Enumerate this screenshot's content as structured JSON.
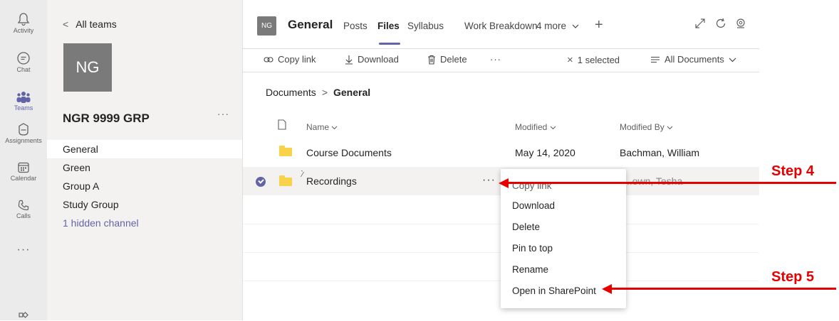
{
  "rail": {
    "items": [
      {
        "label": "Activity",
        "icon": "bell-icon"
      },
      {
        "label": "Chat",
        "icon": "chat-icon"
      },
      {
        "label": "Teams",
        "icon": "teams-icon"
      },
      {
        "label": "Assignments",
        "icon": "assignments-icon"
      },
      {
        "label": "Calendar",
        "icon": "calendar-icon"
      },
      {
        "label": "Calls",
        "icon": "phone-icon"
      },
      {
        "label": "",
        "icon": "more-horizontal-icon"
      }
    ],
    "more_glyph": "···",
    "accent": "#6264a7"
  },
  "sidebar": {
    "back_label": "All teams",
    "team_initials": "NG",
    "team_name": "NGR 9999 GRP",
    "more_glyph": "···",
    "channels": [
      {
        "label": "General",
        "selected": true
      },
      {
        "label": "Green"
      },
      {
        "label": "Group A"
      },
      {
        "label": "Study Group"
      },
      {
        "label": "1 hidden channel"
      }
    ]
  },
  "header": {
    "initials": "NG",
    "title": "General",
    "tabs": [
      "Posts",
      "Files",
      "Syllabus",
      "Work Breakdown",
      "4 more"
    ],
    "active_tab": "Files",
    "add_glyph": "+"
  },
  "toolbar": {
    "copy_link": "Copy link",
    "download": "Download",
    "delete": "Delete",
    "more": "···",
    "selected": "1 selected",
    "view": "All Documents"
  },
  "breadcrumb": {
    "root": "Documents",
    "separator": ">",
    "current": "General"
  },
  "table": {
    "headers": {
      "name": "Name",
      "modified": "Modified",
      "modified_by": "Modified By"
    },
    "rows": [
      {
        "name": "Course Documents",
        "modified": "May 14, 2020",
        "modified_by": "Bachman, William"
      },
      {
        "name": "Recordings",
        "modified": "",
        "modified_by": "...own, Tesha",
        "selected": true
      }
    ],
    "row_more": "···"
  },
  "context_menu": {
    "items": [
      "Copy link",
      "Download",
      "Delete",
      "Pin to top",
      "Rename",
      "Open in SharePoint"
    ]
  },
  "annotations": {
    "step4": "Step 4",
    "step5": "Step 5",
    "color": "#e60000"
  }
}
